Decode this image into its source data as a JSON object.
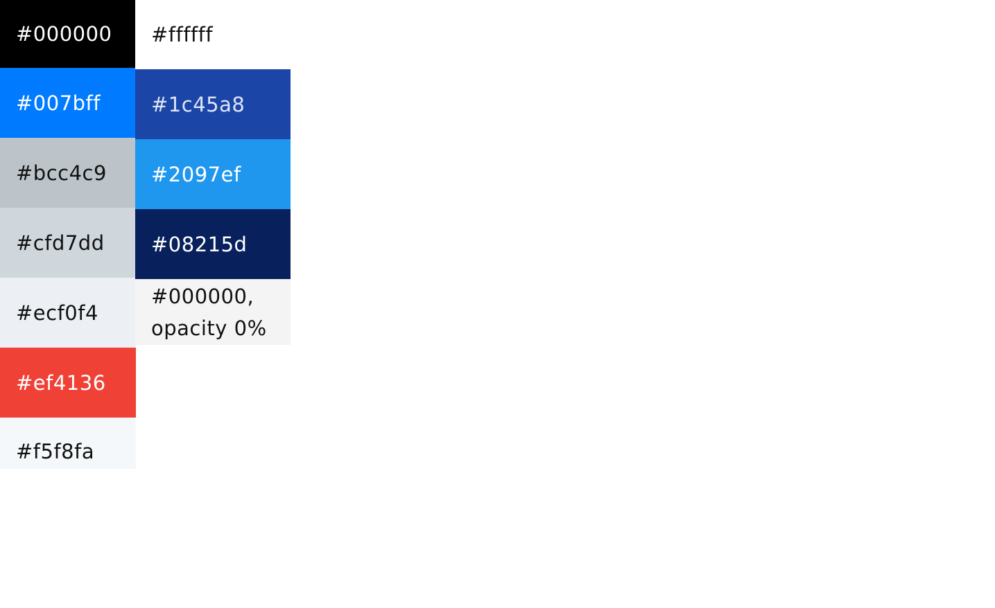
{
  "left_column": [
    {
      "label": "#000000",
      "bg": "#000000",
      "fg": "#ffffff"
    },
    {
      "label": "#007bff",
      "bg": "#007bff",
      "fg": "#ffffff"
    },
    {
      "label": "#bcc4c9",
      "bg": "#bcc4c9",
      "fg": "#111111"
    },
    {
      "label": "#cfd7dd",
      "bg": "#cfd7dd",
      "fg": "#111111"
    },
    {
      "label": "#ecf0f4",
      "bg": "#ecf0f4",
      "fg": "#111111"
    },
    {
      "label": "#ef4136",
      "bg": "#ef4136",
      "fg": "#ffffff"
    },
    {
      "label": "#f5f8fa",
      "bg": "#f5f8fa",
      "fg": "#111111"
    }
  ],
  "right_column": [
    {
      "label": "#ffffff",
      "bg": "#ffffff",
      "fg": "#111111"
    },
    {
      "label": "#1c45a8",
      "bg": "#1c45a8",
      "fg": "#dfe6f5"
    },
    {
      "label": "#2097ef",
      "bg": "#2097ef",
      "fg": "#ffffff"
    },
    {
      "label": "#08215d",
      "bg": "#08215d",
      "fg": "#ffffff"
    },
    {
      "label": "#000000, opacity 0%",
      "bg": "#f4f4f5",
      "fg": "#111111"
    }
  ]
}
